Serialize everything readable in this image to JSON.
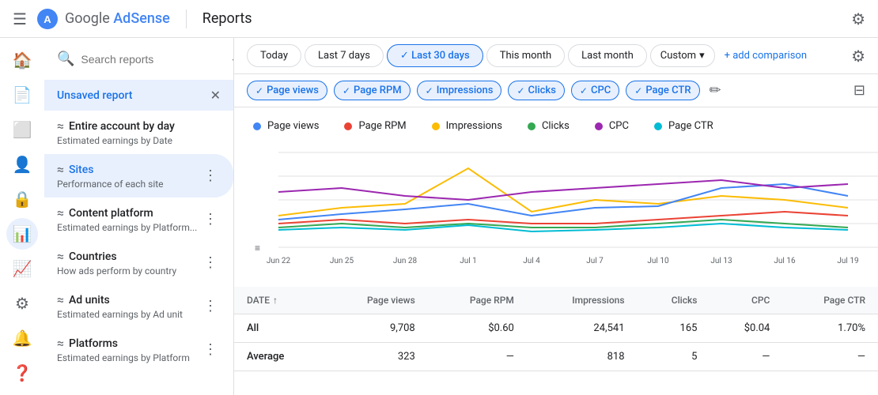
{
  "header": {
    "menu_label": "☰",
    "brand": "Google AdSense",
    "divider": true,
    "title": "Reports",
    "gear_label": "⚙"
  },
  "date_filters": [
    {
      "label": "Today",
      "active": false
    },
    {
      "label": "Last 7 days",
      "active": false
    },
    {
      "label": "Last 30 days",
      "active": true,
      "check": "✓"
    },
    {
      "label": "This month",
      "active": false
    },
    {
      "label": "Last month",
      "active": false
    }
  ],
  "custom_btn": {
    "label": "Custom",
    "arrow": "▾"
  },
  "add_comparison": {
    "label": "+ add comparison"
  },
  "metric_chips": [
    {
      "label": "Page views",
      "active": true,
      "check": "✓"
    },
    {
      "label": "Page RPM",
      "active": true,
      "check": "✓"
    },
    {
      "label": "Impressions",
      "active": true,
      "check": "✓"
    },
    {
      "label": "Clicks",
      "active": true,
      "check": "✓"
    },
    {
      "label": "CPC",
      "active": true,
      "check": "✓"
    },
    {
      "label": "Page CTR",
      "active": true,
      "check": "✓"
    }
  ],
  "chart": {
    "legend": [
      {
        "label": "Page views",
        "color": "#4285f4"
      },
      {
        "label": "Page RPM",
        "color": "#ea4335"
      },
      {
        "label": "Impressions",
        "color": "#fbbc04"
      },
      {
        "label": "Clicks",
        "color": "#34a853"
      },
      {
        "label": "CPC",
        "color": "#9c27b0"
      },
      {
        "label": "Page CTR",
        "color": "#00bcd4"
      }
    ],
    "x_labels": [
      "Jun 22",
      "Jun 25",
      "Jun 28",
      "Jul 1",
      "Jul 4",
      "Jul 7",
      "Jul 10",
      "Jul 13",
      "Jul 16",
      "Jul 19"
    ]
  },
  "table": {
    "columns": [
      "DATE",
      "Page views",
      "Page RPM",
      "Impressions",
      "Clicks",
      "CPC",
      "Page CTR"
    ],
    "rows": [
      {
        "date": "All",
        "page_views": "9,708",
        "page_rpm": "$0.60",
        "impressions": "24,541",
        "clicks": "165",
        "cpc": "$0.04",
        "page_ctr": "1.70%"
      },
      {
        "date": "Average",
        "page_views": "323",
        "page_rpm": "—",
        "impressions": "818",
        "clicks": "5",
        "cpc": "—",
        "page_ctr": "—"
      }
    ]
  },
  "sidebar": {
    "search_placeholder": "Search reports",
    "unsaved_report": "Unsaved report",
    "items": [
      {
        "icon": "≈",
        "title": "Entire account by day",
        "subtitle": "Estimated earnings by Date"
      },
      {
        "icon": "≈",
        "title": "Sites",
        "subtitle": "Performance of each site",
        "active": true
      },
      {
        "icon": "≈",
        "title": "Content platform",
        "subtitle": "Estimated earnings by Platform..."
      },
      {
        "icon": "≈",
        "title": "Countries",
        "subtitle": "How ads perform by country"
      },
      {
        "icon": "≈",
        "title": "Ad units",
        "subtitle": "Estimated earnings by Ad unit"
      },
      {
        "icon": "≈",
        "title": "Platforms",
        "subtitle": "Estimated earnings by Platform"
      }
    ]
  },
  "nav_icons": [
    "🏠",
    "📄",
    "⬜",
    "👤",
    "🔒",
    "📊",
    "📈",
    "⚙",
    "🔔",
    "❓"
  ]
}
